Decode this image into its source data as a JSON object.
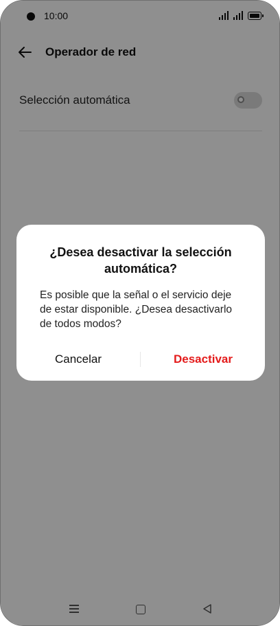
{
  "status_bar": {
    "time": "10:00",
    "icons": [
      "camera-cutout",
      "signal-1-icon",
      "signal-2-icon",
      "battery-icon"
    ]
  },
  "app_bar": {
    "back_icon": "arrow-left-icon",
    "title": "Operador de red"
  },
  "settings": {
    "auto_select_label": "Selección automática",
    "auto_select_enabled": false
  },
  "dialog": {
    "title": "¿Desea desactivar la selección automática?",
    "message": "Es posible que la señal o el servicio deje de estar disponible. ¿Desea desactivarlo de todos modos?",
    "cancel_label": "Cancelar",
    "confirm_label": "Desactivar"
  },
  "nav_bar": {
    "icons": [
      "menu-icon",
      "home-icon",
      "back-triangle-icon"
    ]
  },
  "colors": {
    "accent_destructive": "#e41b1b",
    "scrim": "rgba(0,0,0,0.44)"
  }
}
